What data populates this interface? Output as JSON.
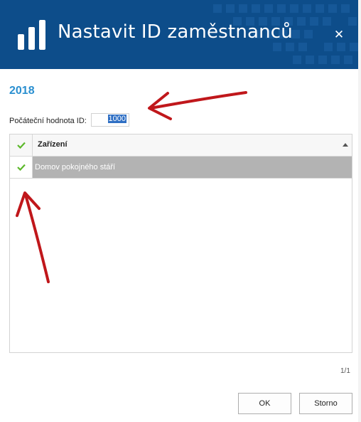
{
  "window": {
    "title": "Nastavit ID zaměstnanců",
    "close_symbol": "✕"
  },
  "header": {
    "year": "2018"
  },
  "start_id": {
    "label": "Počáteční hodnota ID:",
    "value": "1000"
  },
  "grid": {
    "columns": [
      {
        "title": "Zařízení",
        "sort": "ascending"
      }
    ],
    "rows": [
      {
        "checked": true,
        "name": "Domov pokojného stáří"
      }
    ]
  },
  "pager": {
    "text": "1/1"
  },
  "buttons": {
    "ok": "OK",
    "cancel": "Storno"
  },
  "colors": {
    "header": "#0d4d8a",
    "accent": "#2a8fd0",
    "check": "#5cb82a",
    "selected_row": "#b3b3b3",
    "annotation_arrow": "#c0171b"
  }
}
